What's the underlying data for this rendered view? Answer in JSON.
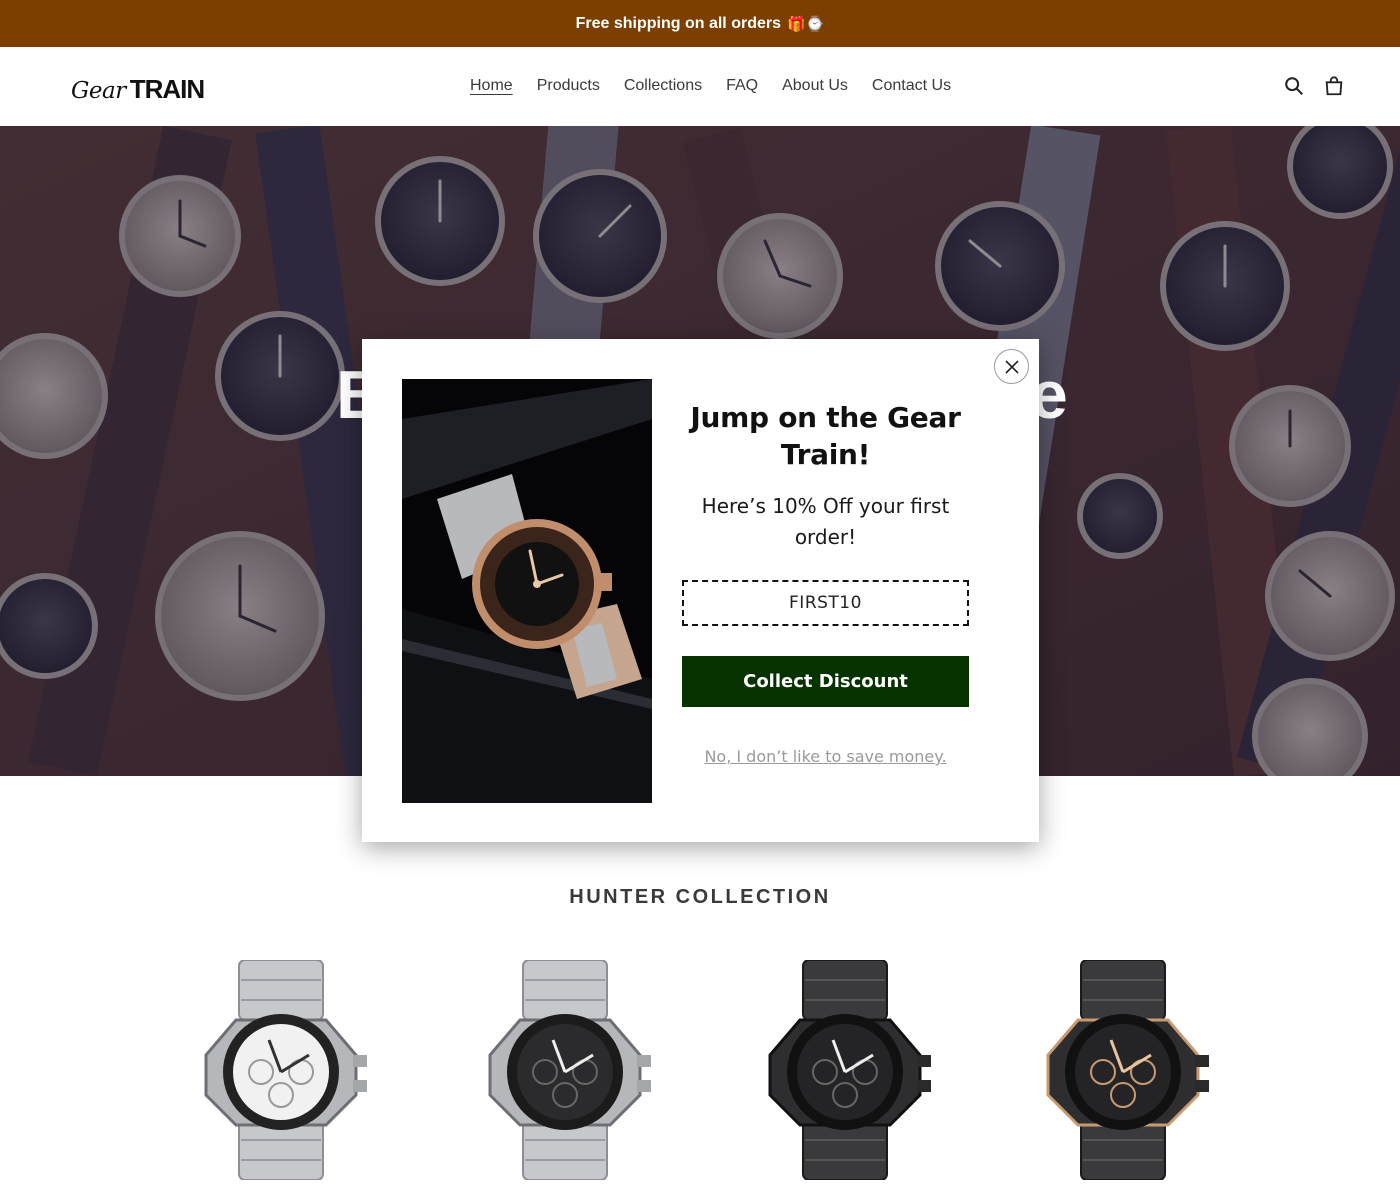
{
  "announcement": {
    "text": "Free shipping on all orders",
    "emoji": "🎁⌚"
  },
  "header": {
    "logo": {
      "script": "Gear",
      "bold": "TRAIN"
    },
    "nav": [
      "Home",
      "Products",
      "Collections",
      "FAQ",
      "About Us",
      "Contact Us"
    ],
    "active_nav": "Home",
    "icons": [
      "search-icon",
      "cart-icon"
    ]
  },
  "hero": {
    "title_visible_left": "B",
    "title_visible_right": "e"
  },
  "section": {
    "title": "HUNTER COLLECTION"
  },
  "products": [
    {
      "variant": "silver-white"
    },
    {
      "variant": "silver-black"
    },
    {
      "variant": "black"
    },
    {
      "variant": "black-rose-gold"
    }
  ],
  "modal": {
    "heading": "Jump on the Gear Train!",
    "subheading": "Here’s 10% Off your first order!",
    "code": "FIRST10",
    "collect_label": "Collect Discount",
    "decline_label": "No, I don’t like to save money.",
    "close_icon": "close-icon"
  },
  "colors": {
    "announcement_bg": "#7c3f00",
    "button_bg": "#063200",
    "hero_overlay": "#28203e"
  }
}
